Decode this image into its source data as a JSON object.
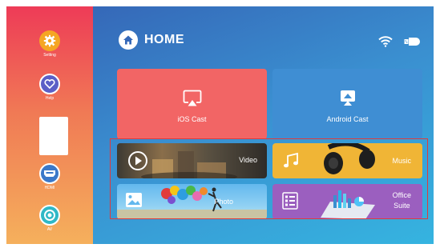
{
  "sidebar": {
    "items": [
      {
        "label": "Setting",
        "icon": "gear-icon",
        "color": "#f5a623"
      },
      {
        "label": "Help",
        "icon": "heart-icon",
        "color": "#5b5fc7"
      },
      {
        "label": "HDMI",
        "icon": "hdmi-icon",
        "color": "#3a78c9"
      },
      {
        "label": "AV",
        "icon": "av-icon",
        "color": "#2fb8c6"
      }
    ]
  },
  "header": {
    "title": "HOME",
    "icons": [
      "home-icon",
      "wifi-icon",
      "usb-icon"
    ]
  },
  "tiles": {
    "ios_cast": {
      "label": "iOS Cast",
      "icon": "screen-mirror-icon",
      "color": "#f26565"
    },
    "android_cast": {
      "label": "Android Cast",
      "icon": "cast-icon",
      "color": "#3f8ed3"
    },
    "video": {
      "label": "Video",
      "icon": "play-icon"
    },
    "music": {
      "label": "Music",
      "icon": "music-note-icon",
      "color": "#f0b536"
    },
    "photo": {
      "label": "Photo",
      "icon": "image-icon"
    },
    "office": {
      "label_line1": "Office",
      "label_line2": "Suite",
      "icon": "document-icon",
      "color": "#9b5fbf"
    }
  },
  "selection": {
    "color": "#e13a3a"
  }
}
